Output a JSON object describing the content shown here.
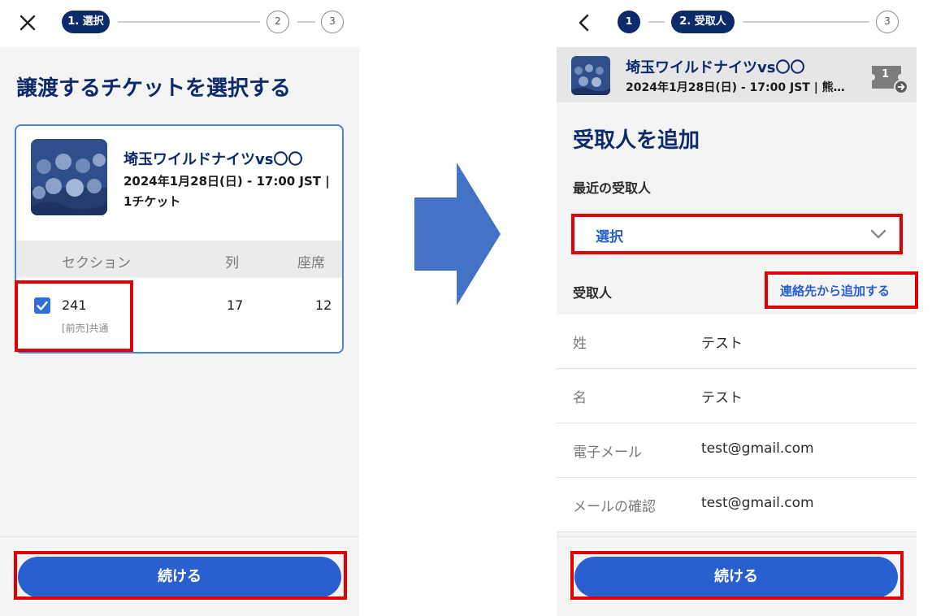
{
  "left_screen": {
    "stepper": {
      "step1_label": "1. 選択",
      "step2_label": "2",
      "step3_label": "3"
    },
    "title": "譲渡するチケットを選択する",
    "event": {
      "name": "埼玉ワイルドナイツvs〇〇",
      "datetime": "2024年1月28日(日) - 17:00 JST |...",
      "ticket_count": "1チケット"
    },
    "table": {
      "headers": [
        "セクション",
        "列",
        "座席"
      ],
      "row": {
        "section": "241",
        "row": "17",
        "seat": "12",
        "note": "[前売]共通",
        "checked": true
      }
    },
    "continue_label": "続ける"
  },
  "right_screen": {
    "stepper": {
      "step1_label": "1",
      "step2_label": "2. 受取人",
      "step3_label": "3"
    },
    "event": {
      "name": "埼玉ワイルドナイツvs〇〇",
      "datetime": "2024年1月28日(日) - 17:00 JST | 熊…",
      "ticket_badge": "1"
    },
    "title": "受取人を追加",
    "recent_label": "最近の受取人",
    "select_placeholder": "選択",
    "recipient_label": "受取人",
    "add_from_contacts": "連絡先から追加する",
    "fields": [
      {
        "label": "姓",
        "value": "テスト"
      },
      {
        "label": "名",
        "value": "テスト"
      },
      {
        "label": "電子メール",
        "value": "test@gmail.com"
      },
      {
        "label": "メールの確認",
        "value": "test@gmail.com"
      }
    ],
    "continue_label": "続ける"
  },
  "colors": {
    "navy": "#0d2a6b",
    "primary_blue": "#2a5fcf",
    "highlight_red": "#e00000",
    "arrow_blue": "#4472c4"
  }
}
